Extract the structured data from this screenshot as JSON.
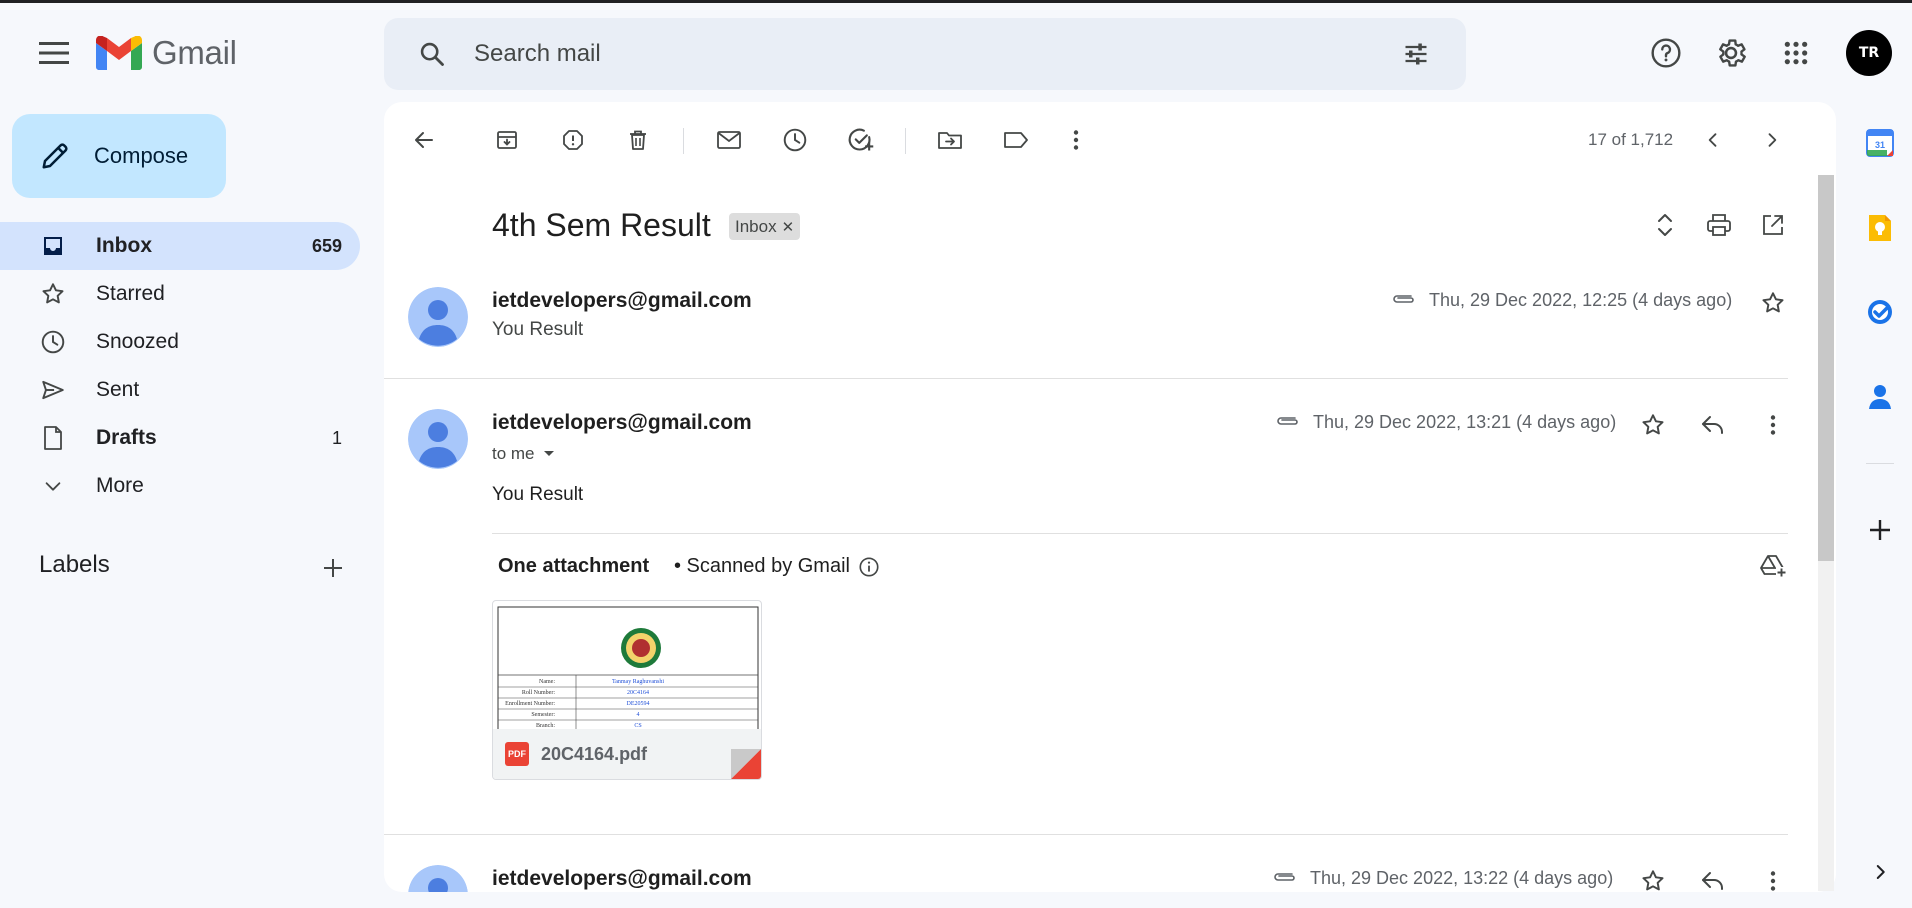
{
  "header": {
    "app_name": "Gmail",
    "search": {
      "placeholder": "Search mail"
    },
    "avatar_initials": "TR"
  },
  "sidebar": {
    "compose_label": "Compose",
    "items": [
      {
        "label": "Inbox",
        "count": "659",
        "icon": "inbox-icon"
      },
      {
        "label": "Starred",
        "count": "",
        "icon": "star-icon"
      },
      {
        "label": "Snoozed",
        "count": "",
        "icon": "clock-icon"
      },
      {
        "label": "Sent",
        "count": "",
        "icon": "send-icon"
      },
      {
        "label": "Drafts",
        "count": "1",
        "icon": "draft-icon"
      },
      {
        "label": "More",
        "count": "",
        "icon": "chevron-down-icon"
      }
    ],
    "labels_heading": "Labels"
  },
  "toolbar": {
    "pager_text": "17 of 1,712"
  },
  "thread": {
    "subject": "4th Sem Result",
    "label_chip": "Inbox",
    "messages": [
      {
        "sender": "ietdevelopers@gmail.com",
        "snippet": "You Result",
        "date": "Thu, 29 Dec 2022, 12:25 (4 days ago)"
      },
      {
        "sender": "ietdevelopers@gmail.com",
        "recipient": "to me",
        "body": "You Result",
        "date": "Thu, 29 Dec 2022, 13:21 (4 days ago)"
      },
      {
        "sender": "ietdevelopers@gmail.com",
        "date": "Thu, 29 Dec 2022, 13:22 (4 days ago)"
      }
    ],
    "attachment": {
      "heading": "One attachment",
      "scan_note": "• Scanned by Gmail",
      "badge": "PDF",
      "file_name": "20C4164.pdf",
      "preview": {
        "rows": [
          {
            "label": "Name:",
            "value": "Tanmay Raghuvanshi"
          },
          {
            "label": "Roll Number:",
            "value": "20C4164"
          },
          {
            "label": "Enrollment Number:",
            "value": "DE20594"
          },
          {
            "label": "Semester:",
            "value": "4"
          },
          {
            "label": "Branch:",
            "value": "CS"
          }
        ]
      }
    }
  },
  "right_rail": {
    "calendar_day": "31"
  },
  "colors": {
    "compose_bg": "#c2e7ff",
    "active_nav_bg": "#d3e3fd",
    "search_bg": "#e9eef6",
    "page_bg": "#f6f8fc"
  }
}
